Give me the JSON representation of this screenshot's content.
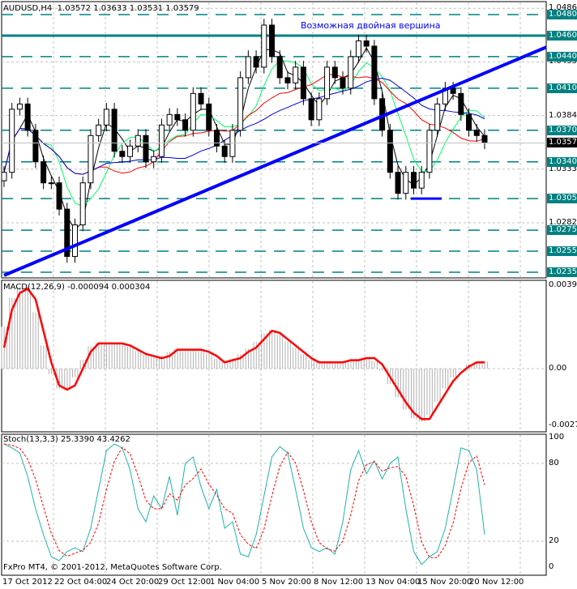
{
  "header": {
    "symbol": "AUDUSD,H4",
    "open": "1.03572",
    "high": "1.03633",
    "low": "1.03531",
    "close": "1.03579"
  },
  "annotation": "Возможная двойная вершина",
  "copyright": "FxPro MT4, © 2001-2012, MetaQuotes Software Corp.",
  "colors": {
    "level": "#008080",
    "trend": "#0000ff",
    "ma_fast": "#000000",
    "ma_mid": "#00ff66",
    "ma_slow": "#ff0000",
    "ma_long": "#0000cc",
    "macd_signal": "#ff0000",
    "stoch_main": "#20b2aa",
    "stoch_signal": "#ff0000"
  },
  "price_axis": {
    "boxed": [
      "1.04800",
      "1.04600",
      "1.04400",
      "1.04100",
      "1.03700",
      "1.03400",
      "1.03050",
      "1.02750",
      "1.02550",
      "1.02350"
    ],
    "plain": [
      "1.04860",
      "1.04350",
      "1.03840",
      "1.03330",
      "1.02820"
    ],
    "current": "1.03579"
  },
  "macd": {
    "label": "MACD(12,26,9) -0.000094 0.000304",
    "axis": [
      "0.00397",
      "0.00",
      "-0.00278"
    ]
  },
  "stoch": {
    "label": "Stoch(13,3,3) 25.3390 43.4262",
    "axis": [
      "100",
      "80",
      "20",
      "0"
    ]
  },
  "time_axis": [
    "17 Oct 2012",
    "22 Oct 04:00",
    "24 Oct 20:00",
    "29 Oct 12:00",
    "1 Nov 04:00",
    "5 Nov 20:00",
    "8 Nov 12:00",
    "13 Nov 04:00",
    "15 Nov 20:00",
    "20 Nov 12:00"
  ],
  "chart_data": {
    "type": "candlestick",
    "symbol": "AUDUSD",
    "timeframe": "H4",
    "ylim": [
      1.0231,
      1.0486
    ],
    "closes": [
      1.033,
      1.039,
      1.0395,
      1.037,
      1.034,
      1.032,
      1.032,
      1.0295,
      1.025,
      1.028,
      1.032,
      1.0365,
      1.0375,
      1.039,
      1.035,
      1.0345,
      1.0355,
      1.0365,
      1.034,
      1.0345,
      1.0375,
      1.0385,
      1.038,
      1.037,
      1.0405,
      1.0395,
      1.037,
      1.0355,
      1.0345,
      1.037,
      1.042,
      1.044,
      1.043,
      1.047,
      1.044,
      1.042,
      1.0415,
      1.043,
      1.04,
      1.038,
      1.04,
      1.043,
      1.042,
      1.041,
      1.044,
      1.0455,
      1.045,
      1.04,
      1.037,
      1.033,
      1.031,
      1.033,
      1.0315,
      1.033,
      1.037,
      1.0395,
      1.041,
      1.0405,
      1.0385,
      1.037,
      1.0365,
      1.0358
    ],
    "levels": [
      1.048,
      1.046,
      1.044,
      1.041,
      1.037,
      1.034,
      1.0305,
      1.0275,
      1.0255,
      1.0235
    ],
    "trendline": [
      1.0232,
      1.0449
    ],
    "macd_signal": [
      0.001,
      0.0028,
      0.0036,
      0.0038,
      0.0033,
      0.0018,
      0.0003,
      -0.0008,
      -0.001,
      -0.0008,
      0.0,
      0.0008,
      0.0012,
      0.0012,
      0.0012,
      0.0012,
      0.0011,
      0.0009,
      0.0007,
      0.0006,
      0.0005,
      0.0006,
      0.0009,
      0.0009,
      0.0009,
      0.0009,
      0.0008,
      0.0006,
      0.0003,
      0.0004,
      0.0005,
      0.0008,
      0.001,
      0.0014,
      0.0018,
      0.0017,
      0.0014,
      0.0011,
      0.0008,
      0.0005,
      0.0003,
      0.0003,
      0.0003,
      0.0003,
      0.0004,
      0.0004,
      0.0005,
      0.0005,
      0.0002,
      -0.0004,
      -0.001,
      -0.0016,
      -0.0021,
      -0.0024,
      -0.0024,
      -0.0018,
      -0.0012,
      -0.0006,
      -0.0002,
      0.0001,
      0.0003,
      0.0003
    ],
    "stoch_main": [
      95,
      92,
      88,
      70,
      45,
      25,
      8,
      5,
      12,
      15,
      12,
      30,
      60,
      90,
      95,
      92,
      75,
      45,
      35,
      55,
      45,
      70,
      40,
      80,
      85,
      62,
      45,
      60,
      30,
      35,
      10,
      8,
      25,
      55,
      85,
      93,
      88,
      60,
      30,
      15,
      12,
      15,
      10,
      35,
      75,
      90,
      72,
      82,
      68,
      80,
      85,
      45,
      12,
      2,
      8,
      12,
      30,
      60,
      92,
      90,
      75,
      25
    ],
    "stoch_ylim": [
      0,
      100
    ]
  }
}
